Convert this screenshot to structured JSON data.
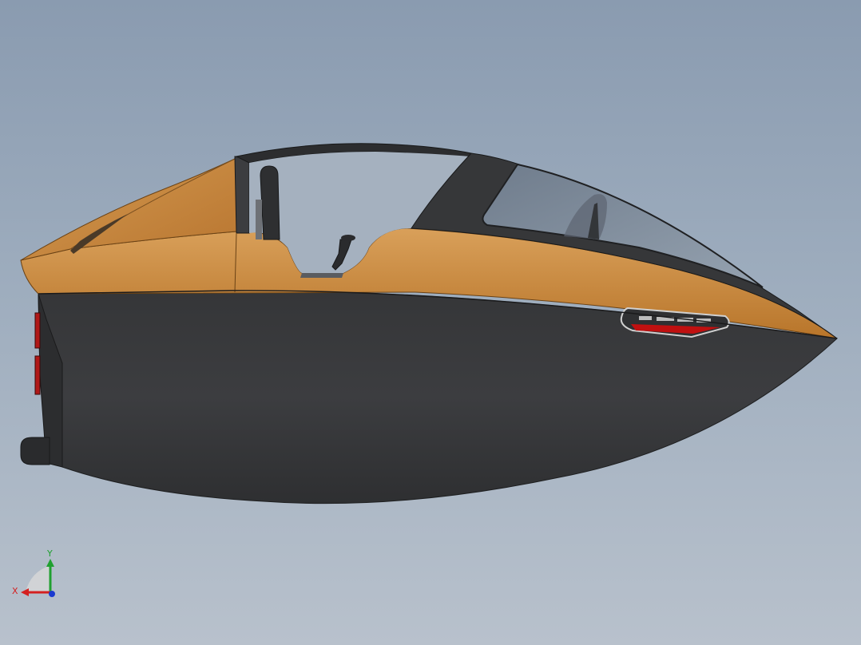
{
  "viewport": {
    "background_top": "#8a9bb0",
    "background_bottom": "#b8c1cc"
  },
  "model": {
    "name": "",
    "colors": {
      "hull_dark": "#3a3b3d",
      "hull_highlight": "#4a4b4e",
      "deck_orange": "#c98a3c",
      "deck_orange_light": "#d9a05a",
      "canopy_glass": "#7d8a99",
      "frame": "#2a2b2d",
      "tail_light_red": "#b01818",
      "vent_red": "#c01010",
      "vent_frame": "#c8c8c8"
    }
  },
  "triad": {
    "x_label": "X",
    "y_label": "Y",
    "x_color": "#d42020",
    "y_color": "#20a030",
    "z_color": "#1a3ad0"
  }
}
